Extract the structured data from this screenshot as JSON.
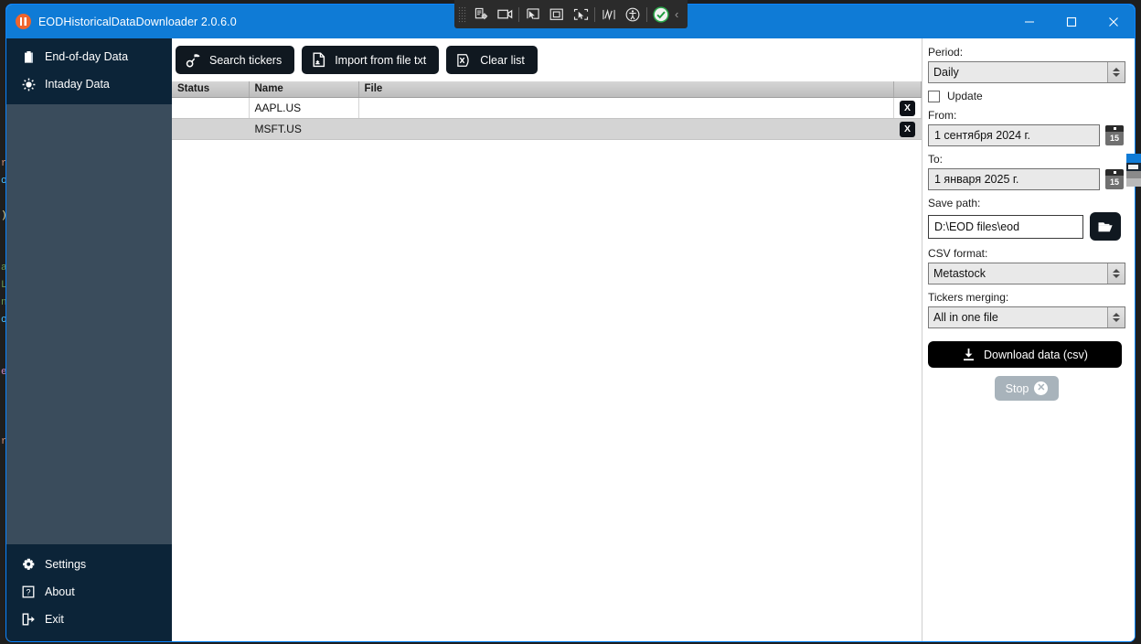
{
  "window": {
    "title": "EODHistoricalDataDownloader 2.0.6.0",
    "app_icon": "equalizer-circle-icon",
    "accent_color": "#0f7bd6",
    "controls": {
      "minimize": "minimize-icon",
      "maximize": "maximize-icon",
      "close": "close-icon"
    }
  },
  "os_overlay": {
    "buttons": [
      "screen-capture-icon",
      "record-video-icon",
      "select-region-icon",
      "select-window-icon",
      "select-screen-icon",
      "scribble-icon",
      "accessibility-icon",
      "status-ok-icon"
    ],
    "collapse": "‹"
  },
  "sidebar": {
    "top_items": [
      {
        "label": "End-of-day Data",
        "icon": "clipboard-icon"
      },
      {
        "label": "Intaday Data",
        "icon": "sun-icon"
      }
    ],
    "bottom_items": [
      {
        "label": "Settings",
        "icon": "gear-icon"
      },
      {
        "label": "About",
        "icon": "question-box-icon"
      },
      {
        "label": "Exit",
        "icon": "exit-arrow-icon"
      }
    ],
    "colors": {
      "dark": "#0c2438",
      "mid": "#3a4c5c"
    }
  },
  "toolbar": {
    "search_tickers": "Search tickers",
    "search_tickers_icon": "ticker-search-icon",
    "import_from_file": "Import from file txt",
    "import_from_file_icon": "file-import-icon",
    "clear_list": "Clear list",
    "clear_list_icon": "clear-x-icon"
  },
  "table": {
    "columns": [
      "Status",
      "Name",
      "File",
      ""
    ],
    "rows": [
      {
        "status": "",
        "name": "AAPL.US",
        "file": "",
        "remove_label": "X"
      },
      {
        "status": "",
        "name": "MSFT.US",
        "file": "",
        "remove_label": "X"
      }
    ]
  },
  "panel": {
    "period_label": "Period:",
    "period_value": "Daily",
    "update_label": "Update",
    "update_checked": false,
    "from_label": "From:",
    "from_value": "1 сентября 2024 г.",
    "to_label": "To:",
    "to_value": "1 января 2025 г.",
    "calendar_day": "15",
    "save_path_label": "Save path:",
    "save_path_value": "D:\\EOD files\\eod",
    "browse_icon": "folder-open-icon",
    "csv_format_label": "CSV format:",
    "csv_format_value": "Metastock",
    "tickers_merging_label": "Tickers merging:",
    "tickers_merging_value": "All in one file",
    "download_label": "Download data (csv)",
    "download_icon": "download-icon",
    "stop_label": "Stop",
    "stop_icon": "stop-circle-x-icon",
    "stop_disabled": true
  },
  "backdrop": {
    "code_fragments": [
      "r",
      "ol",
      ")",
      "a",
      "L",
      "n",
      "ol",
      "e",
      "r"
    ]
  }
}
